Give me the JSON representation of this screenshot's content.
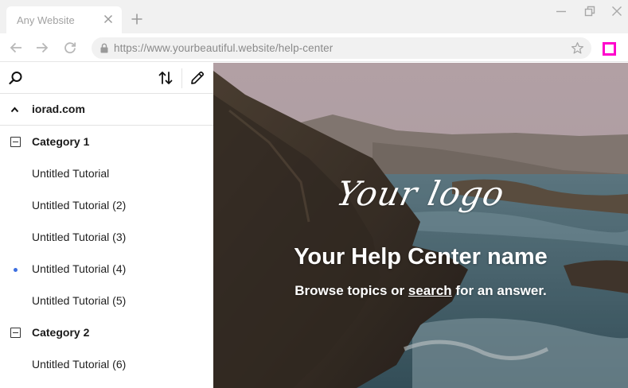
{
  "browser": {
    "tab_title": "Any Website",
    "url": "https://www.yourbeautiful.website/help-center",
    "icons": [
      "close-icon",
      "plus-icon",
      "minimize-icon",
      "restore-icon",
      "close-window-icon",
      "back-arrow-icon",
      "forward-arrow-icon",
      "reload-icon",
      "lock-icon",
      "star-icon",
      "extension-icon"
    ],
    "extension_color": "#ff00cc"
  },
  "sidebar": {
    "toolbar_icons": [
      "search-icon",
      "sort-icon",
      "pencil-icon"
    ],
    "root": {
      "label": "iorad.com",
      "expanded": true
    },
    "categories": [
      {
        "label": "Category 1",
        "expanded": true,
        "items": [
          {
            "label": "Untitled Tutorial",
            "active": false
          },
          {
            "label": "Untitled Tutorial (2)",
            "active": false
          },
          {
            "label": "Untitled Tutorial (3)",
            "active": false
          },
          {
            "label": "Untitled Tutorial (4)",
            "active": true
          },
          {
            "label": "Untitled Tutorial (5)",
            "active": false
          }
        ]
      },
      {
        "label": "Category 2",
        "expanded": true,
        "items": [
          {
            "label": "Untitled Tutorial (6)",
            "active": false
          }
        ]
      }
    ],
    "active_color": "#3d6fe0"
  },
  "hero": {
    "logo_text": "Your logo",
    "title": "Your Help Center name",
    "subtitle_before": "Browse topics or ",
    "subtitle_link": "search",
    "subtitle_after": " for an answer."
  }
}
